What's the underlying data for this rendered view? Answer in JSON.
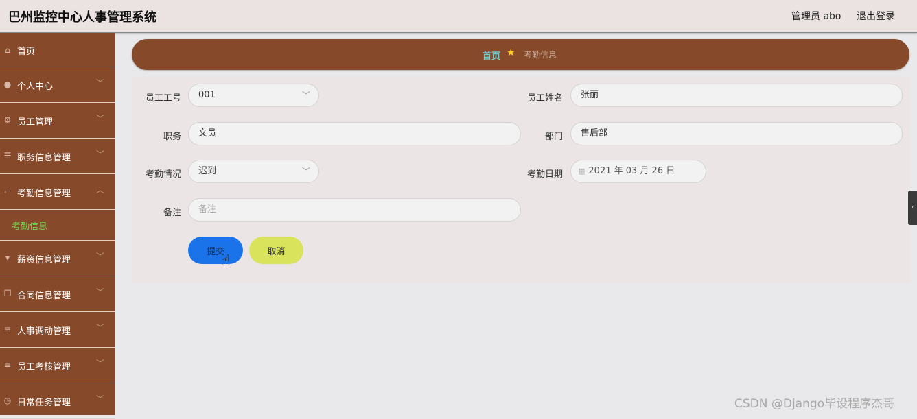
{
  "header": {
    "app_title": "巴州监控中心人事管理系统",
    "user_label": "管理员 abo",
    "logout_label": "退出登录"
  },
  "sidebar": {
    "items": [
      {
        "label": "首页",
        "icon": "home-icon"
      },
      {
        "label": "个人中心",
        "icon": "user-icon"
      },
      {
        "label": "员工管理",
        "icon": "settings-icon"
      },
      {
        "label": "职务信息管理",
        "icon": "sliders-icon"
      },
      {
        "label": "考勤信息管理",
        "icon": "crop-icon",
        "expanded": true
      },
      {
        "label": "薪资信息管理",
        "icon": "pin-icon"
      },
      {
        "label": "合同信息管理",
        "icon": "copy-icon"
      },
      {
        "label": "人事调动管理",
        "icon": "list-icon"
      },
      {
        "label": "员工考核管理",
        "icon": "list-icon"
      },
      {
        "label": "日常任务管理",
        "icon": "clock-icon"
      }
    ],
    "sub_items": [
      {
        "label": "考勤信息",
        "active": true
      }
    ],
    "accent_color": "#864a2b",
    "active_color": "#6fdc4e"
  },
  "breadcrumb": {
    "home": "首页",
    "current": "考勤信息"
  },
  "form": {
    "employee_id": {
      "label": "员工工号",
      "value": "001"
    },
    "employee_name": {
      "label": "员工姓名",
      "value": "张丽"
    },
    "position": {
      "label": "职务",
      "value": "文员"
    },
    "department": {
      "label": "部门",
      "value": "售后部"
    },
    "attendance_status": {
      "label": "考勤情况",
      "value": "迟到"
    },
    "attendance_date": {
      "label": "考勤日期",
      "value": "2021 年 03 月 26 日"
    },
    "remark": {
      "label": "备注",
      "placeholder": "备注"
    },
    "submit_label": "提交",
    "cancel_label": "取消"
  },
  "watermark": "CSDN @Django毕设程序杰哥"
}
